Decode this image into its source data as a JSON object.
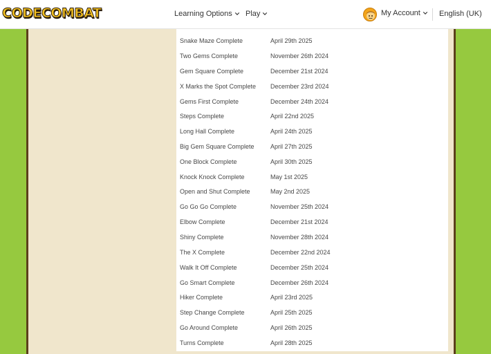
{
  "header": {
    "logo_text": "CODECOMBAT",
    "nav": [
      {
        "label": "Learning Options"
      },
      {
        "label": "Play"
      }
    ],
    "account_label": "My Account",
    "language_label": "English (UK)"
  },
  "achievements": [
    {
      "name": "Snake Maze Complete",
      "date": "April 29th 2025"
    },
    {
      "name": "Two Gems Complete",
      "date": "November 26th 2024"
    },
    {
      "name": "Gem Square Complete",
      "date": "December 21st 2024"
    },
    {
      "name": "X Marks the Spot Complete",
      "date": "December 23rd 2024"
    },
    {
      "name": "Gems First Complete",
      "date": "December 24th 2024"
    },
    {
      "name": "Steps Complete",
      "date": "April 22nd 2025"
    },
    {
      "name": "Long Hall Complete",
      "date": "April 24th 2025"
    },
    {
      "name": "Big Gem Square Complete",
      "date": "April 27th 2025"
    },
    {
      "name": "One Block Complete",
      "date": "April 30th 2025"
    },
    {
      "name": "Knock Knock Complete",
      "date": "May 1st 2025"
    },
    {
      "name": "Open and Shut Complete",
      "date": "May 2nd 2025"
    },
    {
      "name": "Go Go Go Complete",
      "date": "November 25th 2024"
    },
    {
      "name": "Elbow Complete",
      "date": "December 21st 2024"
    },
    {
      "name": "Shiny Complete",
      "date": "November 28th 2024"
    },
    {
      "name": "The X Complete",
      "date": "December 22nd 2024"
    },
    {
      "name": "Walk It Off Complete",
      "date": "December 25th 2024"
    },
    {
      "name": "Go Smart Complete",
      "date": "December 26th 2024"
    },
    {
      "name": "Hiker Complete",
      "date": "April 23rd 2025"
    },
    {
      "name": "Step Change Complete",
      "date": "April 25th 2025"
    },
    {
      "name": "Go Around Complete",
      "date": "April 26th 2025"
    },
    {
      "name": "Turns Complete",
      "date": "April 28th 2025"
    }
  ],
  "colors": {
    "grass": "#96c93f",
    "parchment": "#f0e6cc",
    "wood_border": "#5b3f1c",
    "logo_gold": "#f5c120"
  }
}
